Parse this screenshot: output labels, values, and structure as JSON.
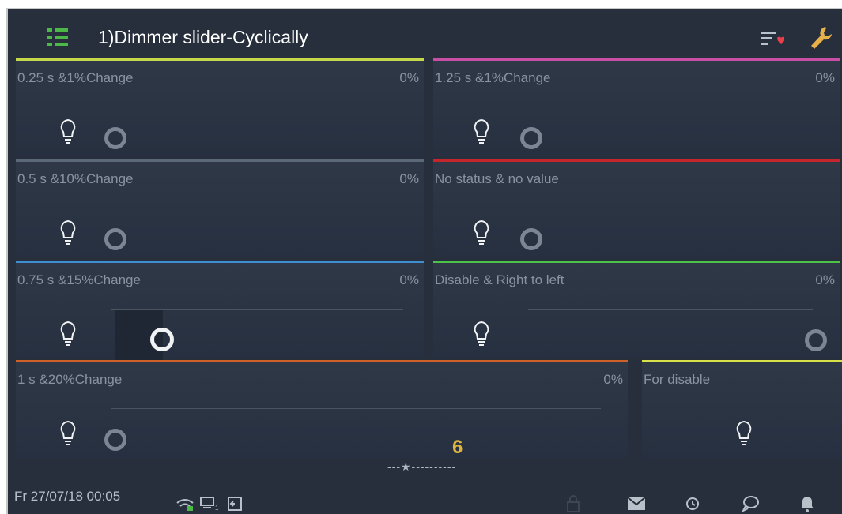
{
  "header": {
    "title": "1)Dimmer slider-Cyclically"
  },
  "tiles": [
    {
      "label": "0.25 s &1%Change",
      "value": "0%",
      "color": "#c5d84a"
    },
    {
      "label": "1.25 s &1%Change",
      "value": "0%",
      "color": "#c94ea6"
    },
    {
      "label": "0.5 s &10%Change",
      "value": "0%",
      "color": "#5a6878"
    },
    {
      "label": "No status & no value",
      "value": "",
      "color": "#c5262c"
    },
    {
      "label": "0.75 s &15%Change",
      "value": "0%",
      "color": "#3f8fd0"
    },
    {
      "label": "Disable & Right to left",
      "value": "0%",
      "color": "#4cc248"
    },
    {
      "label": "1 s &20%Change",
      "value": "0%",
      "color": "#d0602a"
    },
    {
      "label": "For disable",
      "value": "",
      "color": "#d8e04a"
    }
  ],
  "footer": {
    "datetime": "Fr 27/07/18  00:05",
    "page_number": "6",
    "page_dots": "---★----------",
    "icons": [
      "wifi-icon",
      "network-icon",
      "logout-icon",
      "lock-icon",
      "mail-icon",
      "history-icon",
      "chat-icon",
      "bell-icon"
    ]
  }
}
